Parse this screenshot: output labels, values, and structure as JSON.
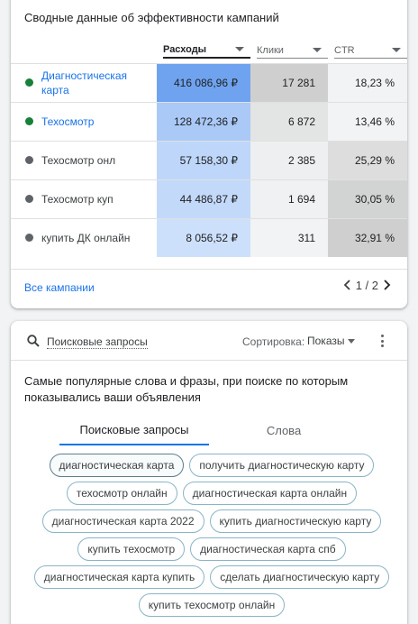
{
  "summary": {
    "title": "Сводные данные об эффективности кампаний",
    "columns": [
      {
        "label": "Расходы",
        "sorted": true
      },
      {
        "label": "Клики",
        "sorted": false
      },
      {
        "label": "CTR",
        "sorted": false
      }
    ],
    "rows": [
      {
        "name": "Диагностическая карта",
        "status": "green",
        "link": true,
        "cost": "416 086,96 ₽",
        "clicks": "17 281",
        "ctr": "18,23 %",
        "cost_level": 1.0,
        "clicks_level": 1.0,
        "ctr_level": 0.0
      },
      {
        "name": "Техосмотр",
        "status": "green",
        "link": true,
        "cost": "128 472,36 ₽",
        "clicks": "6 872",
        "ctr": "13,46 %",
        "cost_level": 0.4,
        "clicks_level": 0.4,
        "ctr_level": 0.0
      },
      {
        "name": "Техосмотр онл",
        "status": "gray",
        "link": false,
        "cost": "57 158,30 ₽",
        "clicks": "2 385",
        "ctr": "25,29 %",
        "cost_level": 0.2,
        "clicks_level": 0.1,
        "ctr_level": 0.6
      },
      {
        "name": "Техосмотр куп",
        "status": "gray",
        "link": false,
        "cost": "44 486,87 ₽",
        "clicks": "1 694",
        "ctr": "30,05 %",
        "cost_level": 0.15,
        "clicks_level": 0.05,
        "ctr_level": 0.9
      },
      {
        "name": "купить ДК онлайн",
        "status": "gray",
        "link": false,
        "cost": "8 056,52 ₽",
        "clicks": "311",
        "ctr": "32,91 %",
        "cost_level": 0.05,
        "clicks_level": 0.0,
        "ctr_level": 1.0
      }
    ],
    "footer": {
      "all_link": "Все кампании",
      "page": "1 / 2"
    }
  },
  "search_terms": {
    "header_label": "Поисковые запросы",
    "sort_label": "Сортировка:",
    "sort_value": "Показы",
    "description": "Самые популярные слова и фразы, при поиске по которым показывались ваши объявления",
    "tabs": [
      "Поисковые запросы",
      "Слова"
    ],
    "active_tab": 0,
    "chips": [
      "диагностическая карта",
      "получить диагностическую карту",
      "техосмотр онлайн",
      "диагностическая карта онлайн",
      "диагностическая карта 2022",
      "купить диагностическую карту",
      "купить техосмотр",
      "диагностическая карта спб",
      "диагностическая карта купить",
      "сделать диагностическую карту",
      "купить техосмотр онлайн"
    ],
    "selected_chip": 0
  },
  "colors": {
    "accent": "#1a73e8",
    "status_green": "#188038",
    "status_gray": "#5f6368",
    "cost_heat_max": "#6fa3ef",
    "cost_heat_min": "#d2e3fc",
    "neutral_heat_max": "#cfcfcf",
    "neutral_heat_min": "#f1f3f4"
  }
}
